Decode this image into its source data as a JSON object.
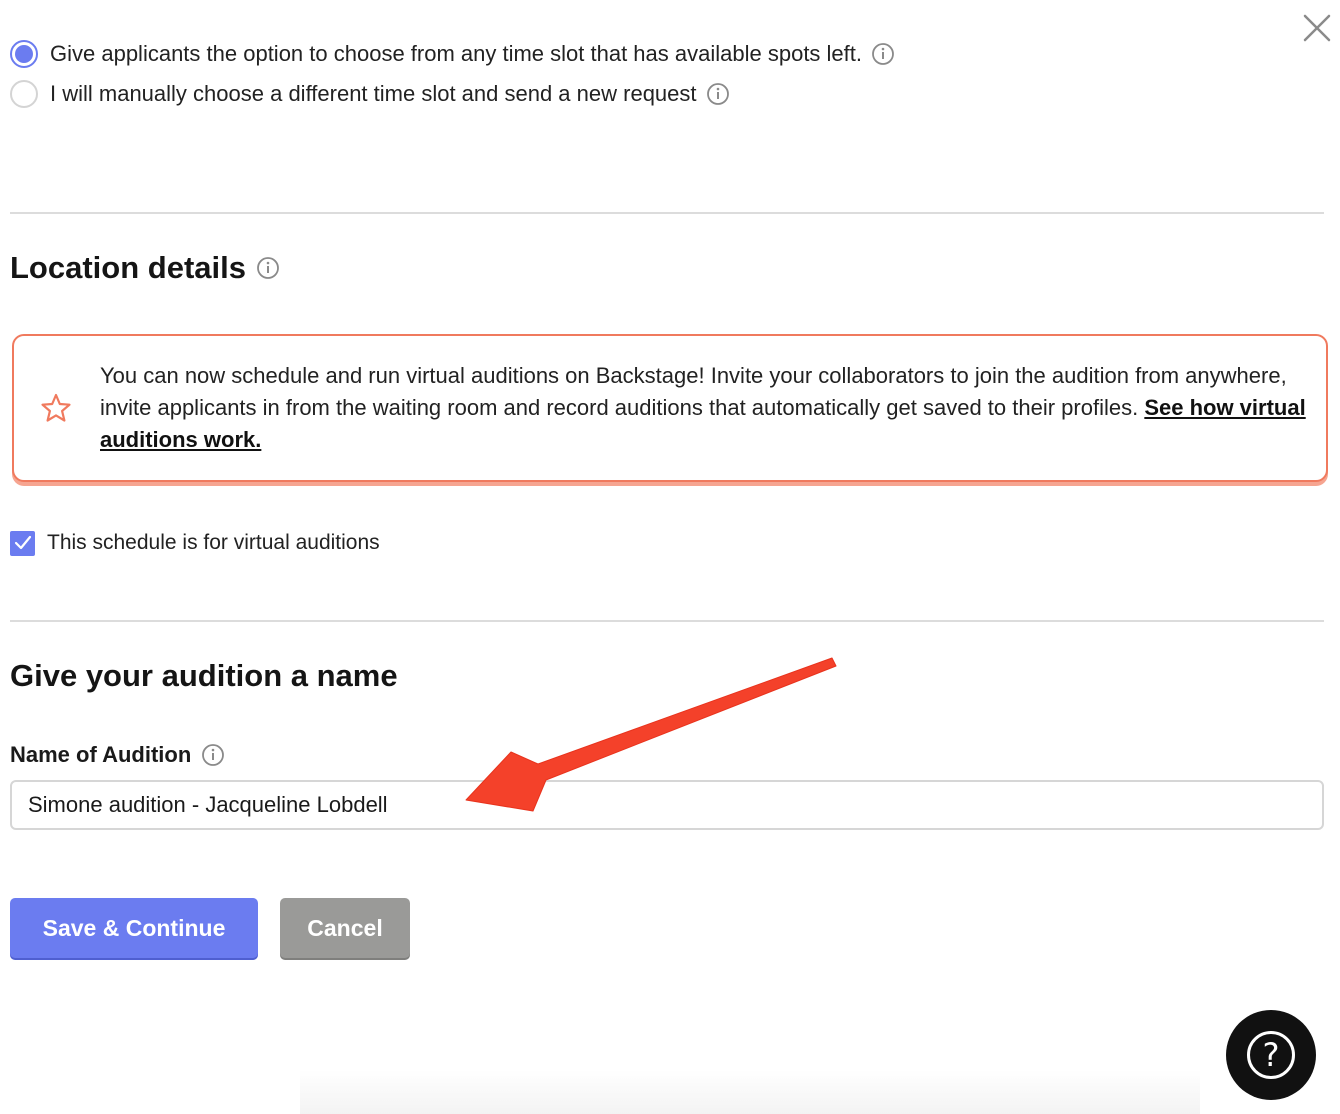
{
  "reschedule_options": {
    "option_any_slot": {
      "label": "Give applicants the option to choose from any time slot that has available spots left.",
      "checked": true
    },
    "option_manual": {
      "label": "I will manually choose a different time slot and send a new request",
      "checked": false
    }
  },
  "location": {
    "heading": "Location details",
    "notice": {
      "text": "You can now schedule and run virtual auditions on Backstage! Invite your collaborators to join the audition from anywhere, invite applicants in from the waiting room and record auditions that automatically get saved to their profiles. ",
      "link_label": "See how virtual auditions work.",
      "icon": "star-icon"
    },
    "virtual_checkbox": {
      "label": "This schedule is for virtual auditions",
      "checked": true
    }
  },
  "audition_name": {
    "heading": "Give your audition a name",
    "field_label": "Name of Audition",
    "field_value": "Simone audition - Jacqueline Lobdell"
  },
  "actions": {
    "save_label": "Save & Continue",
    "cancel_label": "Cancel"
  },
  "help": {
    "glyph": "?"
  },
  "colors": {
    "accent": "#6b7cf0",
    "notice_border": "#f07a5e",
    "cancel": "#9a9a98",
    "annotation_arrow": "#f4412a"
  }
}
